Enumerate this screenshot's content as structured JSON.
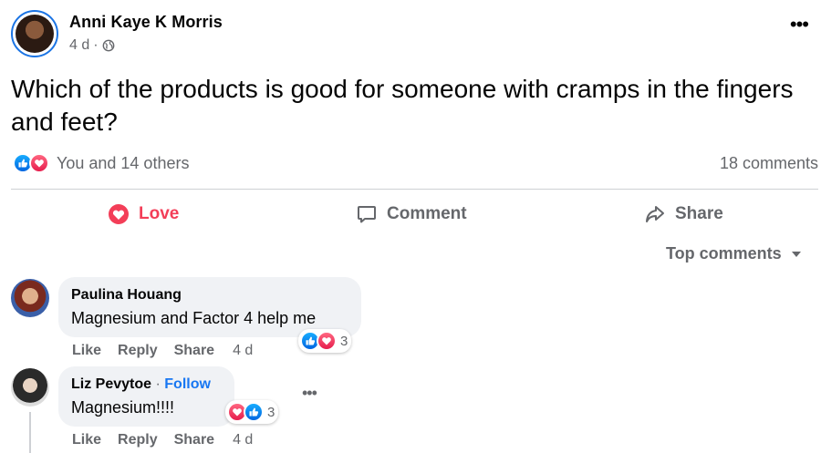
{
  "post": {
    "author": "Anni Kaye K Morris",
    "time": "4 d",
    "text": "Which of the products is good for someone with cramps in the fingers and feet?",
    "reactions_text": "You and 14 others",
    "comment_count": "18 comments"
  },
  "actions": {
    "love": "Love",
    "comment": "Comment",
    "share": "Share"
  },
  "sort": {
    "label": "Top comments"
  },
  "comments": [
    {
      "author": "Paulina Houang",
      "text": "Magnesium and Factor 4 help me",
      "like": "Like",
      "reply": "Reply",
      "share": "Share",
      "time": "4 d",
      "reaction_count": "3",
      "reactions": [
        "like-icon",
        "love-icon"
      ]
    },
    {
      "author": "Liz Pevytoe",
      "separator": "·",
      "follow": "Follow",
      "text": "Magnesium!!!!",
      "like": "Like",
      "reply": "Reply",
      "share": "Share",
      "time": "4 d",
      "reaction_count": "3",
      "reactions": [
        "love-icon",
        "like-icon"
      ]
    }
  ],
  "colors": {
    "accent_blue": "#1877f2",
    "love_red": "#f33e58",
    "muted": "#65676b",
    "bubble": "#f0f2f5"
  }
}
